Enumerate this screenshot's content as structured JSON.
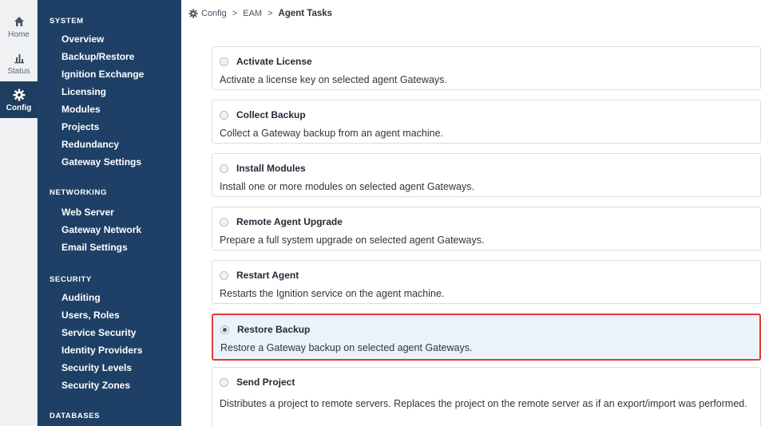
{
  "rail": {
    "items": [
      {
        "label": "Home",
        "icon": "home-icon"
      },
      {
        "label": "Status",
        "icon": "bar-chart-icon"
      },
      {
        "label": "Config",
        "icon": "gear-icon",
        "active": true
      }
    ]
  },
  "sidebar": {
    "system": {
      "heading": "SYSTEM",
      "items": [
        "Overview",
        "Backup/Restore",
        "Ignition Exchange",
        "Licensing",
        "Modules",
        "Projects",
        "Redundancy",
        "Gateway Settings"
      ]
    },
    "networking": {
      "heading": "NETWORKING",
      "items": [
        "Web Server",
        "Gateway Network",
        "Email Settings"
      ]
    },
    "security": {
      "heading": "SECURITY",
      "items": [
        "Auditing",
        "Users, Roles",
        "Service Security",
        "Identity Providers",
        "Security Levels",
        "Security Zones"
      ]
    },
    "databases": {
      "heading": "DATABASES"
    }
  },
  "breadcrumb": {
    "root": "Config",
    "middle": "EAM",
    "current": "Agent Tasks"
  },
  "tasks": [
    {
      "title": "Activate License",
      "desc": "Activate a license key on selected agent Gateways.",
      "selected": false
    },
    {
      "title": "Collect Backup",
      "desc": "Collect a Gateway backup from an agent machine.",
      "selected": false
    },
    {
      "title": "Install Modules",
      "desc": "Install one or more modules on selected agent Gateways.",
      "selected": false
    },
    {
      "title": "Remote Agent Upgrade",
      "desc": "Prepare a full system upgrade on selected agent Gateways.",
      "selected": false
    },
    {
      "title": "Restart Agent",
      "desc": "Restarts the Ignition service on the agent machine.",
      "selected": false
    },
    {
      "title": "Restore Backup",
      "desc": "Restore a Gateway backup on selected agent Gateways.",
      "selected": true
    },
    {
      "title": "Send Project",
      "desc": "Distributes a project to remote servers. Replaces the project on the remote server as if an export/import was performed.",
      "selected": false
    }
  ],
  "colors": {
    "sidebar_bg": "#1f4066",
    "rail_active_bg": "#1d3e60",
    "selected_border": "#e53935",
    "selected_bg": "#eaf3fb"
  }
}
